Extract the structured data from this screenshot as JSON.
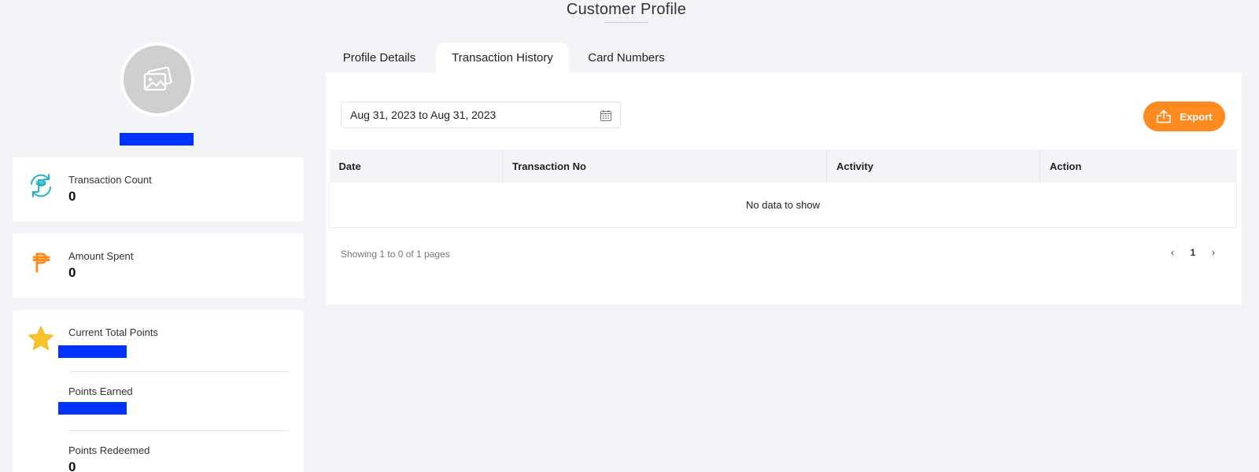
{
  "page": {
    "title": "Customer Profile"
  },
  "sidebar": {
    "stats": [
      {
        "icon": "peso-refresh-icon",
        "label": "Transaction Count",
        "value": "0"
      },
      {
        "icon": "peso-icon",
        "label": "Amount Spent",
        "value": "0"
      }
    ],
    "points": {
      "icon": "star-icon",
      "current_label": "Current Total Points",
      "earned_label": "Points Earned",
      "redeemed_label": "Points Redeemed",
      "redeemed_value": "0"
    }
  },
  "tabs": [
    {
      "label": "Profile Details",
      "active": false
    },
    {
      "label": "Transaction History",
      "active": true
    },
    {
      "label": "Card Numbers",
      "active": false
    }
  ],
  "transactions": {
    "date_range": "Aug 31, 2023 to Aug 31, 2023",
    "export_label": "Export",
    "columns": [
      "Date",
      "Transaction No",
      "Activity",
      "Action"
    ],
    "empty_message": "No data to show",
    "pagination_info": "Showing 1 to 0 of 1 pages",
    "pager": {
      "prev": "‹",
      "page": "1",
      "next": "›"
    }
  },
  "colors": {
    "accent": "#ff8a1f",
    "redaction": "#0033ff",
    "teal": "#21b3c4",
    "star": "#f7c52b"
  }
}
